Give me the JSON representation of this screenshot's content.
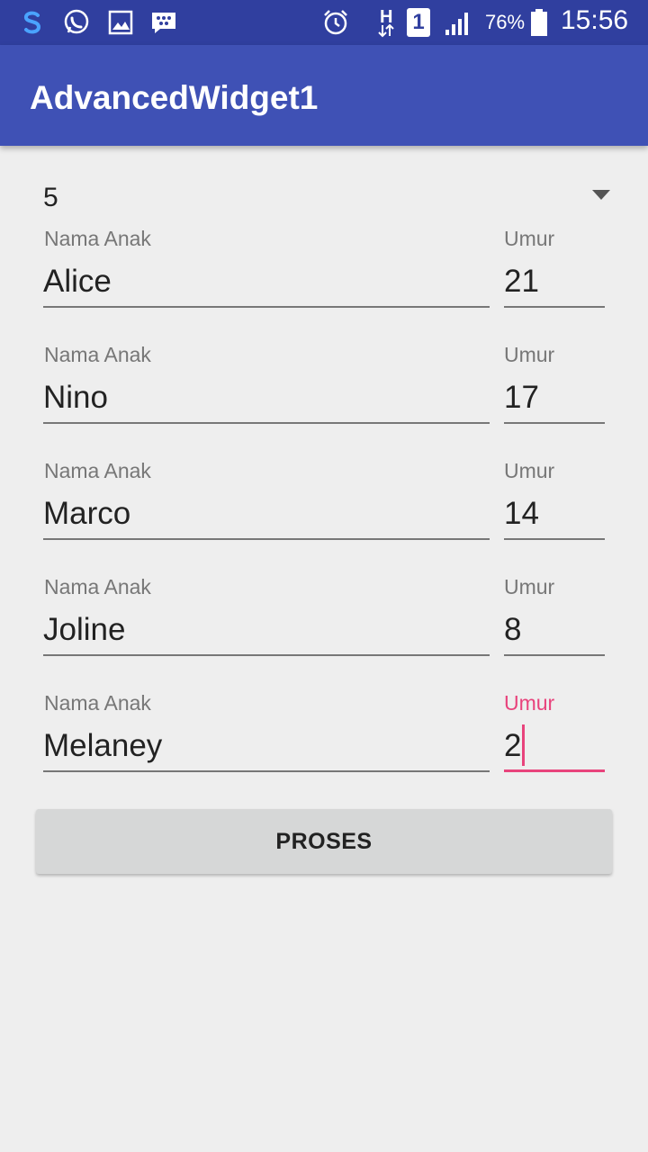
{
  "status_bar": {
    "icons": [
      "skype-icon",
      "whatsapp-icon",
      "gallery-icon",
      "bbm-icon",
      "alarm-icon",
      "network-h-icon",
      "sim-1-icon",
      "signal-icon",
      "battery-icon"
    ],
    "network_label": "H",
    "sim_label": "1",
    "battery": "76%",
    "time": "15:56"
  },
  "app_bar": {
    "title": "AdvancedWidget1"
  },
  "spinner": {
    "value": "5"
  },
  "children": [
    {
      "name_label": "Nama Anak",
      "name": "Alice",
      "age_label": "Umur",
      "age": "21"
    },
    {
      "name_label": "Nama Anak",
      "name": "Nino",
      "age_label": "Umur",
      "age": "17"
    },
    {
      "name_label": "Nama Anak",
      "name": "Marco",
      "age_label": "Umur",
      "age": "14"
    },
    {
      "name_label": "Nama Anak",
      "name": "Joline",
      "age_label": "Umur",
      "age": "8"
    },
    {
      "name_label": "Nama Anak",
      "name": "Melaney",
      "age_label": "Umur",
      "age": "2"
    }
  ],
  "button": {
    "label": "PROSES"
  },
  "colors": {
    "status_bar": "#303f9f",
    "app_bar": "#3f51b5",
    "accent": "#e8437c",
    "background": "#eeeeee"
  }
}
